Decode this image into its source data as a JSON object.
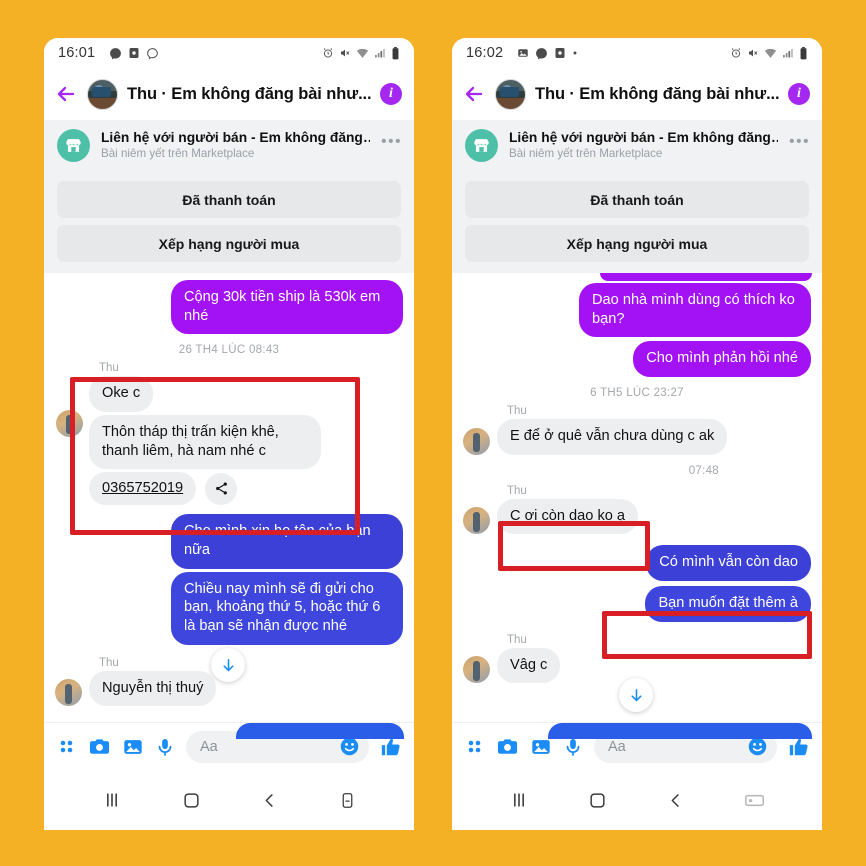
{
  "background_color": "#f5b125",
  "colors": {
    "purple_bubble": "#a312f5",
    "blue_bubble": "#3c40d6",
    "grey_bubble": "#edeef0",
    "annotation_red": "#d81f26",
    "accent_blue": "#1b8cf5",
    "marketplace_green": "#4fc0a8",
    "info_purple": "#a428f0"
  },
  "phone_left": {
    "status_bar": {
      "time": "16:01",
      "left_icons": [
        "messenger-icon",
        "app-square-icon",
        "messenger-outline-icon"
      ],
      "right_icons": [
        "alarm-icon",
        "mute-icon",
        "wifi-icon",
        "signal-icon",
        "battery-icon"
      ]
    },
    "header": {
      "back_icon": "back-arrow-icon",
      "avatar": "contact-avatar",
      "title": "Thu · Em không đăng bài như...",
      "info_icon": "info-icon"
    },
    "marketplace": {
      "icon": "marketplace-store-icon",
      "title": "Liên hệ với người bán - Em không đăng…",
      "subtitle": "Bài niêm yết trên Marketplace",
      "overflow": "…",
      "buttons": [
        {
          "label": "Đã thanh toán"
        },
        {
          "label": "Xếp hạng người mua"
        }
      ]
    },
    "messages": [
      {
        "type": "bubble",
        "side": "out",
        "style": "purple",
        "text": "Cộng 30k tiền ship là 530k em nhé"
      },
      {
        "type": "timestamp",
        "text": "26 TH4 LÚC 08:43"
      },
      {
        "type": "sender",
        "text": "Thu"
      },
      {
        "type": "bubble",
        "side": "in",
        "style": "grey",
        "text": "Oke c"
      },
      {
        "type": "bubble",
        "side": "in",
        "style": "grey",
        "text": "Thôn tháp thị trấn kiện khê, thanh liêm, hà nam nhé c"
      },
      {
        "type": "phone",
        "side": "in",
        "text": "0365752019",
        "share_icon": "share-icon"
      },
      {
        "type": "bubble",
        "side": "out",
        "style": "blue",
        "text": "Cho mình xin họ tên của bạn nữa"
      },
      {
        "type": "bubble",
        "side": "out",
        "style": "blue",
        "text": "Chiều nay mình sẽ đi gửi cho bạn, khoảng thứ 5, hoặc thứ 6 là bạn sẽ nhận được nhé"
      },
      {
        "type": "sender",
        "text": "Thu"
      },
      {
        "type": "bubble",
        "side": "in",
        "style": "grey",
        "text": "Nguyễn thị thuý"
      }
    ],
    "scroll_down_icon": "scroll-down-icon",
    "composer": {
      "icons": [
        "apps-grid-icon",
        "camera-icon",
        "gallery-icon",
        "microphone-icon"
      ],
      "placeholder": "Aa",
      "emoji_icon": "emoji-icon",
      "like_icon": "thumbs-up-icon"
    },
    "navbar": [
      "recents-icon",
      "home-icon",
      "back-icon",
      "keyboard-icon"
    ]
  },
  "phone_right": {
    "status_bar": {
      "time": "16:02",
      "left_icons": [
        "gallery-icon",
        "messenger-icon",
        "app-square-icon",
        "dot-icon"
      ],
      "right_icons": [
        "alarm-icon",
        "mute-icon",
        "wifi-icon",
        "signal-icon",
        "battery-icon"
      ]
    },
    "header": {
      "back_icon": "back-arrow-icon",
      "avatar": "contact-avatar",
      "title": "Thu · Em không đăng bài như...",
      "info_icon": "info-icon"
    },
    "marketplace": {
      "icon": "marketplace-store-icon",
      "title": "Liên hệ với người bán - Em không đăng…",
      "subtitle": "Bài niêm yết trên Marketplace",
      "overflow": "…",
      "buttons": [
        {
          "label": "Đã thanh toán"
        },
        {
          "label": "Xếp hạng người mua"
        }
      ]
    },
    "messages": [
      {
        "type": "bubble",
        "side": "out",
        "style": "purple",
        "text": "Dao nhà mình dùng có thích ko bạn?"
      },
      {
        "type": "bubble",
        "side": "out",
        "style": "purple",
        "text": "Cho mình phản hồi nhé"
      },
      {
        "type": "timestamp",
        "text": "6 TH5 LÚC 23:27"
      },
      {
        "type": "sender",
        "text": "Thu"
      },
      {
        "type": "bubble",
        "side": "in",
        "style": "grey",
        "text": "E để ở quê vẫn chưa dùng c ak"
      },
      {
        "type": "timestamp_right",
        "text": "07:48"
      },
      {
        "type": "sender",
        "text": "Thu"
      },
      {
        "type": "bubble",
        "side": "in",
        "style": "grey",
        "text": "C ơi còn dao ko ạ"
      },
      {
        "type": "bubble",
        "side": "out",
        "style": "blue",
        "text": "Có mình vẫn còn dao"
      },
      {
        "type": "bubble",
        "side": "out",
        "style": "blue",
        "text": "Bạn muốn đặt thêm à"
      },
      {
        "type": "sender",
        "text": "Thu"
      },
      {
        "type": "bubble",
        "side": "in",
        "style": "grey",
        "text": "Vâg c"
      }
    ],
    "scroll_down_icon": "scroll-down-icon",
    "composer": {
      "icons": [
        "apps-grid-icon",
        "camera-icon",
        "gallery-icon",
        "microphone-icon"
      ],
      "placeholder": "Aa",
      "emoji_icon": "emoji-icon",
      "like_icon": "thumbs-up-icon"
    },
    "navbar": [
      "recents-icon",
      "home-icon",
      "back-icon",
      "keyboard-icon"
    ]
  }
}
